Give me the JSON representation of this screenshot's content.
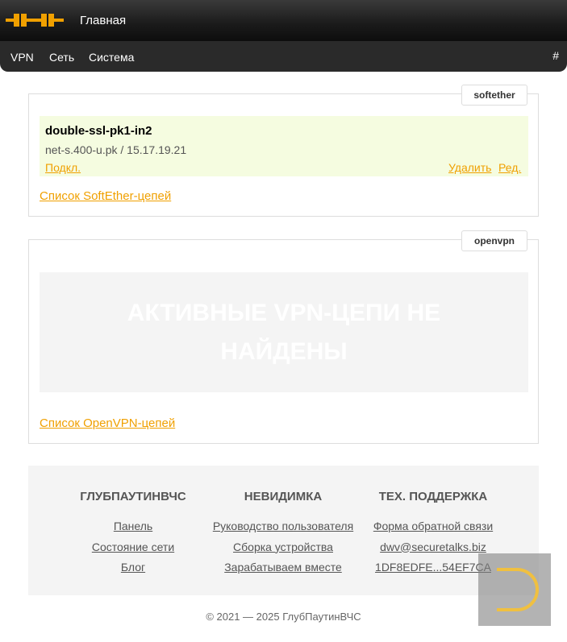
{
  "header": {
    "title": "Главная"
  },
  "nav": {
    "items": [
      "VPN",
      "Сеть",
      "Система"
    ],
    "hash": "#"
  },
  "softether": {
    "tag": "softether",
    "chain": {
      "name": "double-ssl-pk1-in2",
      "host": "net-s.400-u.pk / 15.17.19.21",
      "connect_label": "Подкл.",
      "delete_label": "Удалить",
      "edit_label": "Ред."
    },
    "list_link": "Список SoftEther-цепей"
  },
  "openvpn": {
    "tag": "openvpn",
    "empty_text": "Активные VPN-цепи не найдены",
    "list_link": "Список OpenVPN-цепей"
  },
  "footer": {
    "columns": [
      {
        "title": "ГлубПаутинВЧС",
        "links": [
          "Панель",
          "Состояние сети",
          "Блог"
        ]
      },
      {
        "title": "Невидимка",
        "links": [
          "Руководство пользователя",
          "Сборка устройства",
          "Зарабатываем вместе"
        ]
      },
      {
        "title": "Тех. поддержка",
        "links": [
          "Форма обратной связи",
          "dwv@securetalks.biz",
          "1DF8EDFE...54EF7CA"
        ]
      }
    ],
    "copyright": "© 2021 — 2025 ГлубПаутинВЧС"
  },
  "colors": {
    "accent": "#f0a000",
    "chain_bg": "#f5fce0",
    "topbar": "#1a1a1a"
  }
}
